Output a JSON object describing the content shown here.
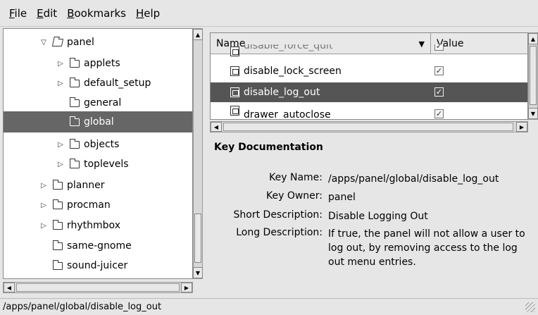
{
  "menubar": {
    "file": {
      "mnemonic": "F",
      "rest": "ile"
    },
    "edit": {
      "mnemonic": "E",
      "rest": "dit"
    },
    "bookmarks": {
      "mnemonic": "B",
      "rest": "ookmarks"
    },
    "help": {
      "mnemonic": "H",
      "rest": "elp"
    }
  },
  "tree": {
    "items": [
      {
        "label": "panel",
        "expander": "▽",
        "state": "expanded"
      },
      {
        "label": "applets",
        "expander": "▷"
      },
      {
        "label": "default_setup",
        "expander": "▷"
      },
      {
        "label": "general",
        "expander": ""
      },
      {
        "label": "global",
        "expander": "",
        "selected": true
      },
      {
        "label": "objects",
        "expander": "▷"
      },
      {
        "label": "toplevels",
        "expander": "▷"
      },
      {
        "label": "planner",
        "expander": "▷"
      },
      {
        "label": "procman",
        "expander": "▷"
      },
      {
        "label": "rhythmbox",
        "expander": "▷"
      },
      {
        "label": "same-gnome",
        "expander": ""
      },
      {
        "label": "sound-juicer",
        "expander": ""
      }
    ]
  },
  "list": {
    "header_name": "Name",
    "header_value": "Value",
    "rows": [
      {
        "name": "disable_force_quit",
        "checked": true
      },
      {
        "name": "disable_lock_screen",
        "checked": true
      },
      {
        "name": "disable_log_out",
        "checked": true,
        "selected": true
      },
      {
        "name": "drawer_autoclose",
        "checked": true
      }
    ]
  },
  "doc": {
    "title": "Key Documentation",
    "key_name_label": "Key Name:",
    "key_name": "/apps/panel/global/disable_log_out",
    "key_owner_label": "Key Owner:",
    "key_owner": "panel",
    "short_desc_label": "Short Description:",
    "short_desc": "Disable Logging Out",
    "long_desc_label": "Long Description:",
    "long_desc": "If true, the panel will not allow a user to log out, by removing access to the log out menu entries."
  },
  "status": {
    "path": "/apps/panel/global/disable_log_out"
  }
}
